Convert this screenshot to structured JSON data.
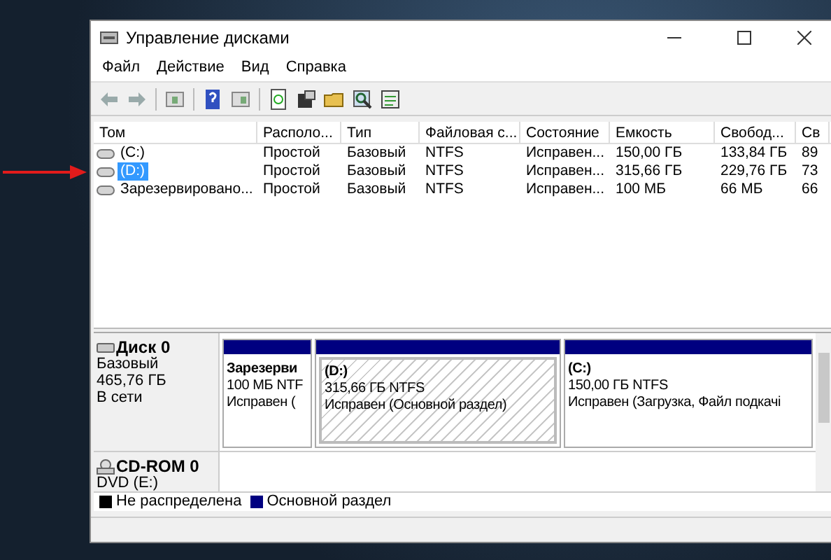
{
  "window": {
    "title": "Управление дисками"
  },
  "menu": [
    "Файл",
    "Действие",
    "Вид",
    "Справка"
  ],
  "table": {
    "columns": [
      "Том",
      "Располо...",
      "Тип",
      "Файловая с...",
      "Состояние",
      "Емкость",
      "Свобод...",
      "Св"
    ],
    "rows": [
      {
        "cells": [
          "(C:)",
          "Простой",
          "Базовый",
          "NTFS",
          "Исправен...",
          "150,00 ГБ",
          "133,84 ГБ",
          "89"
        ],
        "selected": false
      },
      {
        "cells": [
          "(D:)",
          "Простой",
          "Базовый",
          "NTFS",
          "Исправен...",
          "315,66 ГБ",
          "229,76 ГБ",
          "73"
        ],
        "selected": true
      },
      {
        "cells": [
          "Зарезервировано...",
          "Простой",
          "Базовый",
          "NTFS",
          "Исправен...",
          "100 МБ",
          "66 МБ",
          "66"
        ],
        "selected": false
      }
    ]
  },
  "disks": [
    {
      "kind": "disk",
      "name": "Диск 0",
      "lines": [
        "Базовый",
        "465,76 ГБ",
        "В сети"
      ],
      "partitions": [
        {
          "title": "Зарезерви",
          "size": "100 МБ NTF",
          "status": "Исправен (",
          "selected": false
        },
        {
          "title": "(D:)",
          "size": "315,66 ГБ NTFS",
          "status": "Исправен (Основной раздел)",
          "selected": true
        },
        {
          "title": "(C:)",
          "size": "150,00 ГБ NTFS",
          "status": "Исправен (Загрузка, Файл подкачі",
          "selected": false
        }
      ]
    },
    {
      "kind": "cdrom",
      "name": "CD-ROM 0",
      "lines": [
        "DVD (E:)"
      ]
    }
  ],
  "legend": [
    {
      "label": "Не распределена",
      "color": "#000000"
    },
    {
      "label": "Основной раздел",
      "color": "#000080"
    }
  ]
}
